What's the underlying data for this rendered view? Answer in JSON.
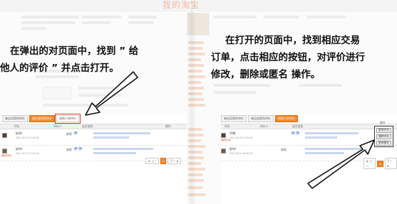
{
  "header": {
    "site_title": "我的淘宝"
  },
  "instructions": {
    "left_line1": "在弹出的对页面中，找到 ” 给",
    "left_line2": "他人的评价 ” 并点击打开。",
    "right_line1": "在打开的页面中，找到相应交易",
    "right_line2": "订单，点击相应的按钮，对评价进行",
    "right_line3": "修改，删除或匿名 操作。"
  },
  "left_panel": {
    "tabs": [
      "来自买家的评价",
      "来自卖家的评价",
      "给他人的评价"
    ],
    "highlighted_tab_index": 2,
    "columns": [
      "评论",
      "评价人",
      "宝贝信息",
      "操作"
    ],
    "filter_value": "评论",
    "rows": [
      {
        "user_label": "",
        "rating": "好评！",
        "time": "2011-03-23 17:06:26",
        "who": "商家",
        "eyes": "👁"
      },
      {
        "user_label": "我的评价",
        "rating": "好评！",
        "time": "2011-03-19 17:16:16",
        "who": "商家",
        "eyes": "👁👁"
      }
    ],
    "pager": {
      "prev": "◄ 上一",
      "current": "1",
      "next": "下一 ►"
    }
  },
  "right_panel": {
    "tabs": [
      "来自买家的评价",
      "来自卖家的评价",
      "给他人的评价"
    ],
    "columns": [
      "评论",
      "评价人",
      "宝贝信息",
      "操作"
    ],
    "filter_value": "评论",
    "rows": [
      {
        "user_label": "我的评价",
        "rating": "不错",
        "time": "2011-03-23 17:06:26",
        "who": "",
        "eyes": "👁👁"
      },
      {
        "user_label": "",
        "rating": "好评！",
        "time": "2011-03-11 09:06:15",
        "who": "商家",
        "eyes": ""
      }
    ],
    "ops_header": "操作",
    "action_buttons": [
      "更改评价",
      "删除评价",
      "更改匿名"
    ],
    "pager": {
      "prev": "◄ 上一",
      "current": "1",
      "next": "下一 ►"
    }
  },
  "colors": {
    "accent_orange": "#f08a30",
    "highlight_red": "#d63a1b",
    "arrow": "#111111"
  }
}
